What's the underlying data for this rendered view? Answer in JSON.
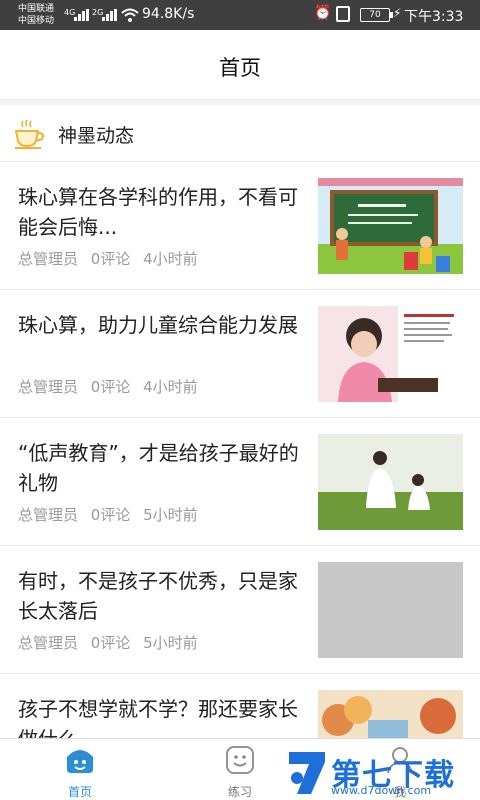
{
  "status_bar": {
    "carrier1": "中国联通",
    "carrier2": "中国移动",
    "sig1": "4G",
    "sig2": "2G",
    "net_speed": "94.8K/s",
    "battery": "70",
    "time": "下午3:33"
  },
  "header": {
    "title": "首页"
  },
  "section": {
    "title": "神墨动态",
    "icon": "coffee-cup-icon"
  },
  "articles": [
    {
      "title": "珠心算在各学科的作用，不看可能会后悔...",
      "author": "总管理员",
      "comments": "0评论",
      "time": "4小时前",
      "thumb": "classroom-cartoon"
    },
    {
      "title": "珠心算，助力儿童综合能力发展",
      "author": "总管理员",
      "comments": "0评论",
      "time": "4小时前",
      "thumb": "girl-abacus"
    },
    {
      "title": "“低声教育”，才是给孩子最好的礼物",
      "author": "总管理员",
      "comments": "0评论",
      "time": "5小时前",
      "thumb": "mother-child"
    },
    {
      "title": "有时，不是孩子不优秀，只是家长太落后",
      "author": "总管理员",
      "comments": "0评论",
      "time": "5小时前",
      "thumb": "blank"
    },
    {
      "title": "孩子不想学就不学？那还要家长做什么",
      "author": "",
      "comments": "",
      "time": "",
      "thumb": "autumn-illustration"
    }
  ],
  "tabs": [
    {
      "label": "首页",
      "icon": "home-icon",
      "active": true
    },
    {
      "label": "练习",
      "icon": "practice-icon",
      "active": false
    },
    {
      "label": "我",
      "icon": "profile-icon",
      "active": false
    }
  ],
  "watermark": {
    "text": "第七下载站",
    "url": "www.d7down.com"
  },
  "colors": {
    "accent": "#2a8fd6",
    "statusbar": "#3f3f3f",
    "meta_text": "#9a9a9a"
  }
}
